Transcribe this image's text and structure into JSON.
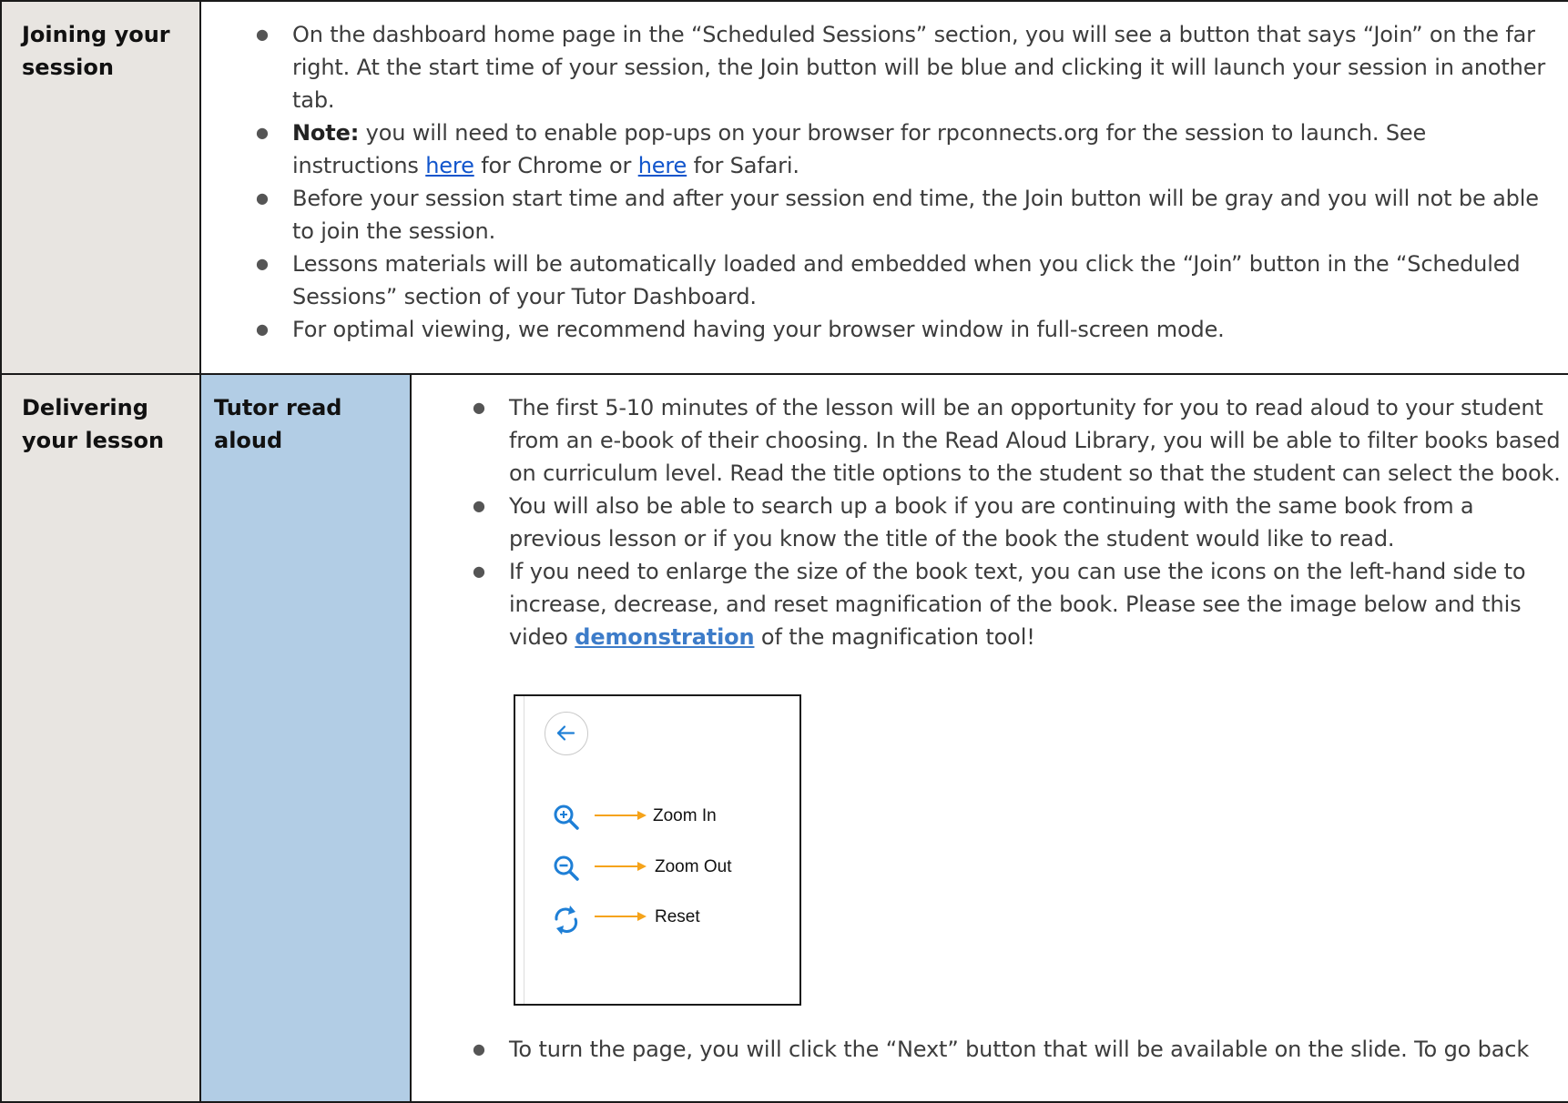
{
  "row1": {
    "label": "Joining your session",
    "bullets": {
      "b1": "On the dashboard home page in the “Scheduled Sessions” section, you will see a button that says “Join” on the far right. At the start time of your session, the Join button will be blue and clicking it will launch your session in another tab.",
      "b2_bold": "Note:",
      "b2_text1": " you will need to enable pop-ups on your browser for rpconnects.org for the session to launch. See instructions ",
      "b2_link1": "here",
      "b2_text2": " for Chrome or ",
      "b2_link2": "here",
      "b2_text3": " for Safari.",
      "b3": "Before your session start time and after your session end time, the Join button will be gray and you will not be able to join the session.",
      "b4": "Lessons materials will be automatically loaded and embedded when you click the “Join” button in the “Scheduled Sessions” section of your Tutor Dashboard.",
      "b5": "For optimal viewing, we recommend having your browser window in full-screen mode."
    }
  },
  "row2": {
    "label": "Delivering your lesson",
    "sublabel": "Tutor read aloud",
    "bullets": {
      "b1": "The first 5-10 minutes of the lesson will be an opportunity for you to read aloud to your student from an e-book of their choosing. In the Read Aloud Library, you will be able to filter books based on curriculum level. Read the title options to the student so that the student can select the book.",
      "b2": "You will also be able to search up a book if you are continuing with the same book from a previous lesson or if you know the title of the book the student would like to read.",
      "b3_text1": "If you need to enlarge the size of the book text, you can use the icons on the left-hand side to increase, decrease, and reset magnification of the book.  Please see the image below and this video ",
      "b3_link": "demonstration",
      "b3_text2": " of the magnification tool!",
      "b4": "To turn the page, you will click the “Next” button that will be available on the slide. To go back"
    },
    "figure": {
      "zoom_in": "Zoom In",
      "zoom_out": "Zoom Out",
      "reset": "Reset"
    }
  },
  "colors": {
    "label_bg": "#e8e5e1",
    "sublabel_bg": "#b2cde5",
    "link": "#1155cc",
    "icon_blue": "#1e7fd6",
    "arrow_orange": "#f5a31a"
  },
  "icons": [
    "bullet-dot",
    "back-arrow-icon",
    "zoom-in-icon",
    "zoom-out-icon",
    "reset-icon",
    "orange-arrow-icon"
  ]
}
